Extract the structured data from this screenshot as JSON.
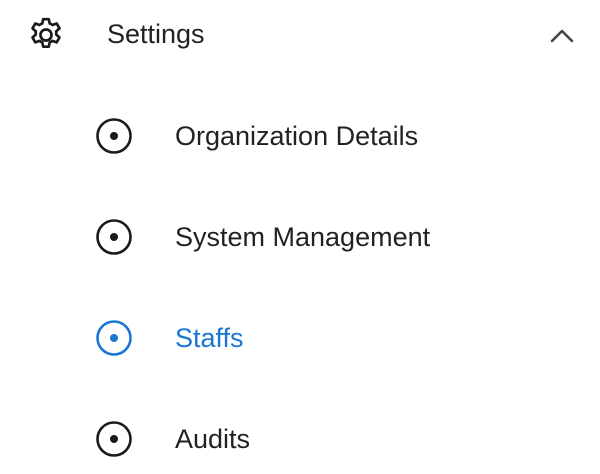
{
  "colors": {
    "text": "#222222",
    "active": "#1976d2"
  },
  "section": {
    "label": "Settings",
    "icon": "gear-icon",
    "expanded": true,
    "expand_icon": "chevron-up-icon"
  },
  "items": [
    {
      "label": "Organization Details",
      "icon": "radio-dot-icon",
      "active": false
    },
    {
      "label": "System Management",
      "icon": "radio-dot-icon",
      "active": false
    },
    {
      "label": "Staffs",
      "icon": "radio-dot-icon",
      "active": true
    },
    {
      "label": "Audits",
      "icon": "radio-dot-icon",
      "active": false
    }
  ]
}
